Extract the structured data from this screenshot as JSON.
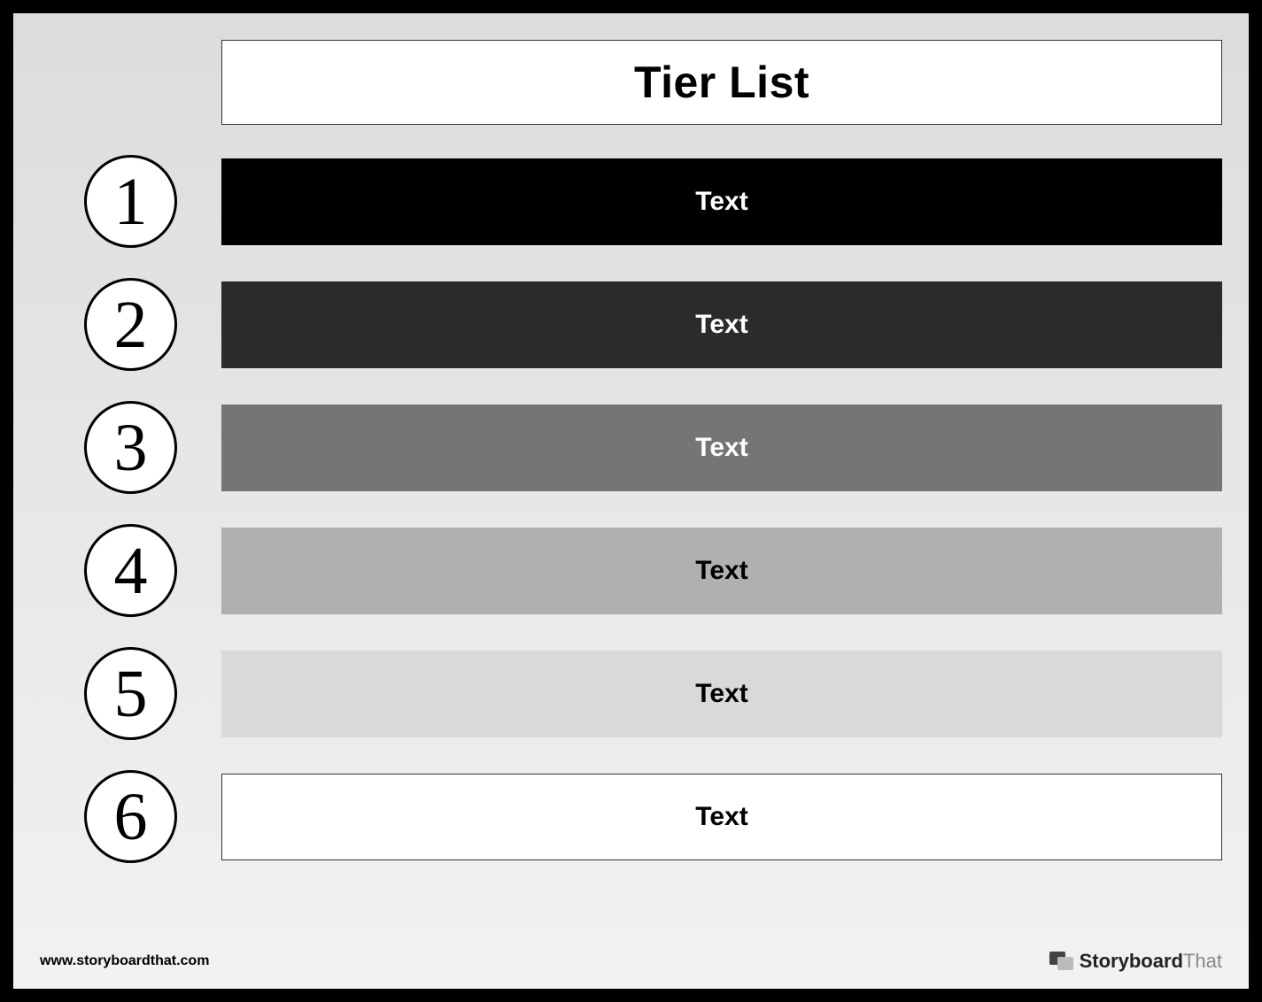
{
  "title": "Tier List",
  "tiers": [
    {
      "number": "1",
      "label": "Text",
      "bg": "#000000",
      "fg": "#ffffff",
      "border": false
    },
    {
      "number": "2",
      "label": "Text",
      "bg": "#2b2b2b",
      "fg": "#ffffff",
      "border": false
    },
    {
      "number": "3",
      "label": "Text",
      "bg": "#757575",
      "fg": "#ffffff",
      "border": false
    },
    {
      "number": "4",
      "label": "Text",
      "bg": "#b0b0b0",
      "fg": "#000000",
      "border": false
    },
    {
      "number": "5",
      "label": "Text",
      "bg": "#d9d9d9",
      "fg": "#000000",
      "border": false
    },
    {
      "number": "6",
      "label": "Text",
      "bg": "#ffffff",
      "fg": "#000000",
      "border": true
    }
  ],
  "footer": {
    "url": "www.storyboardthat.com",
    "brand_strong": "Storyboard",
    "brand_light": "That"
  }
}
